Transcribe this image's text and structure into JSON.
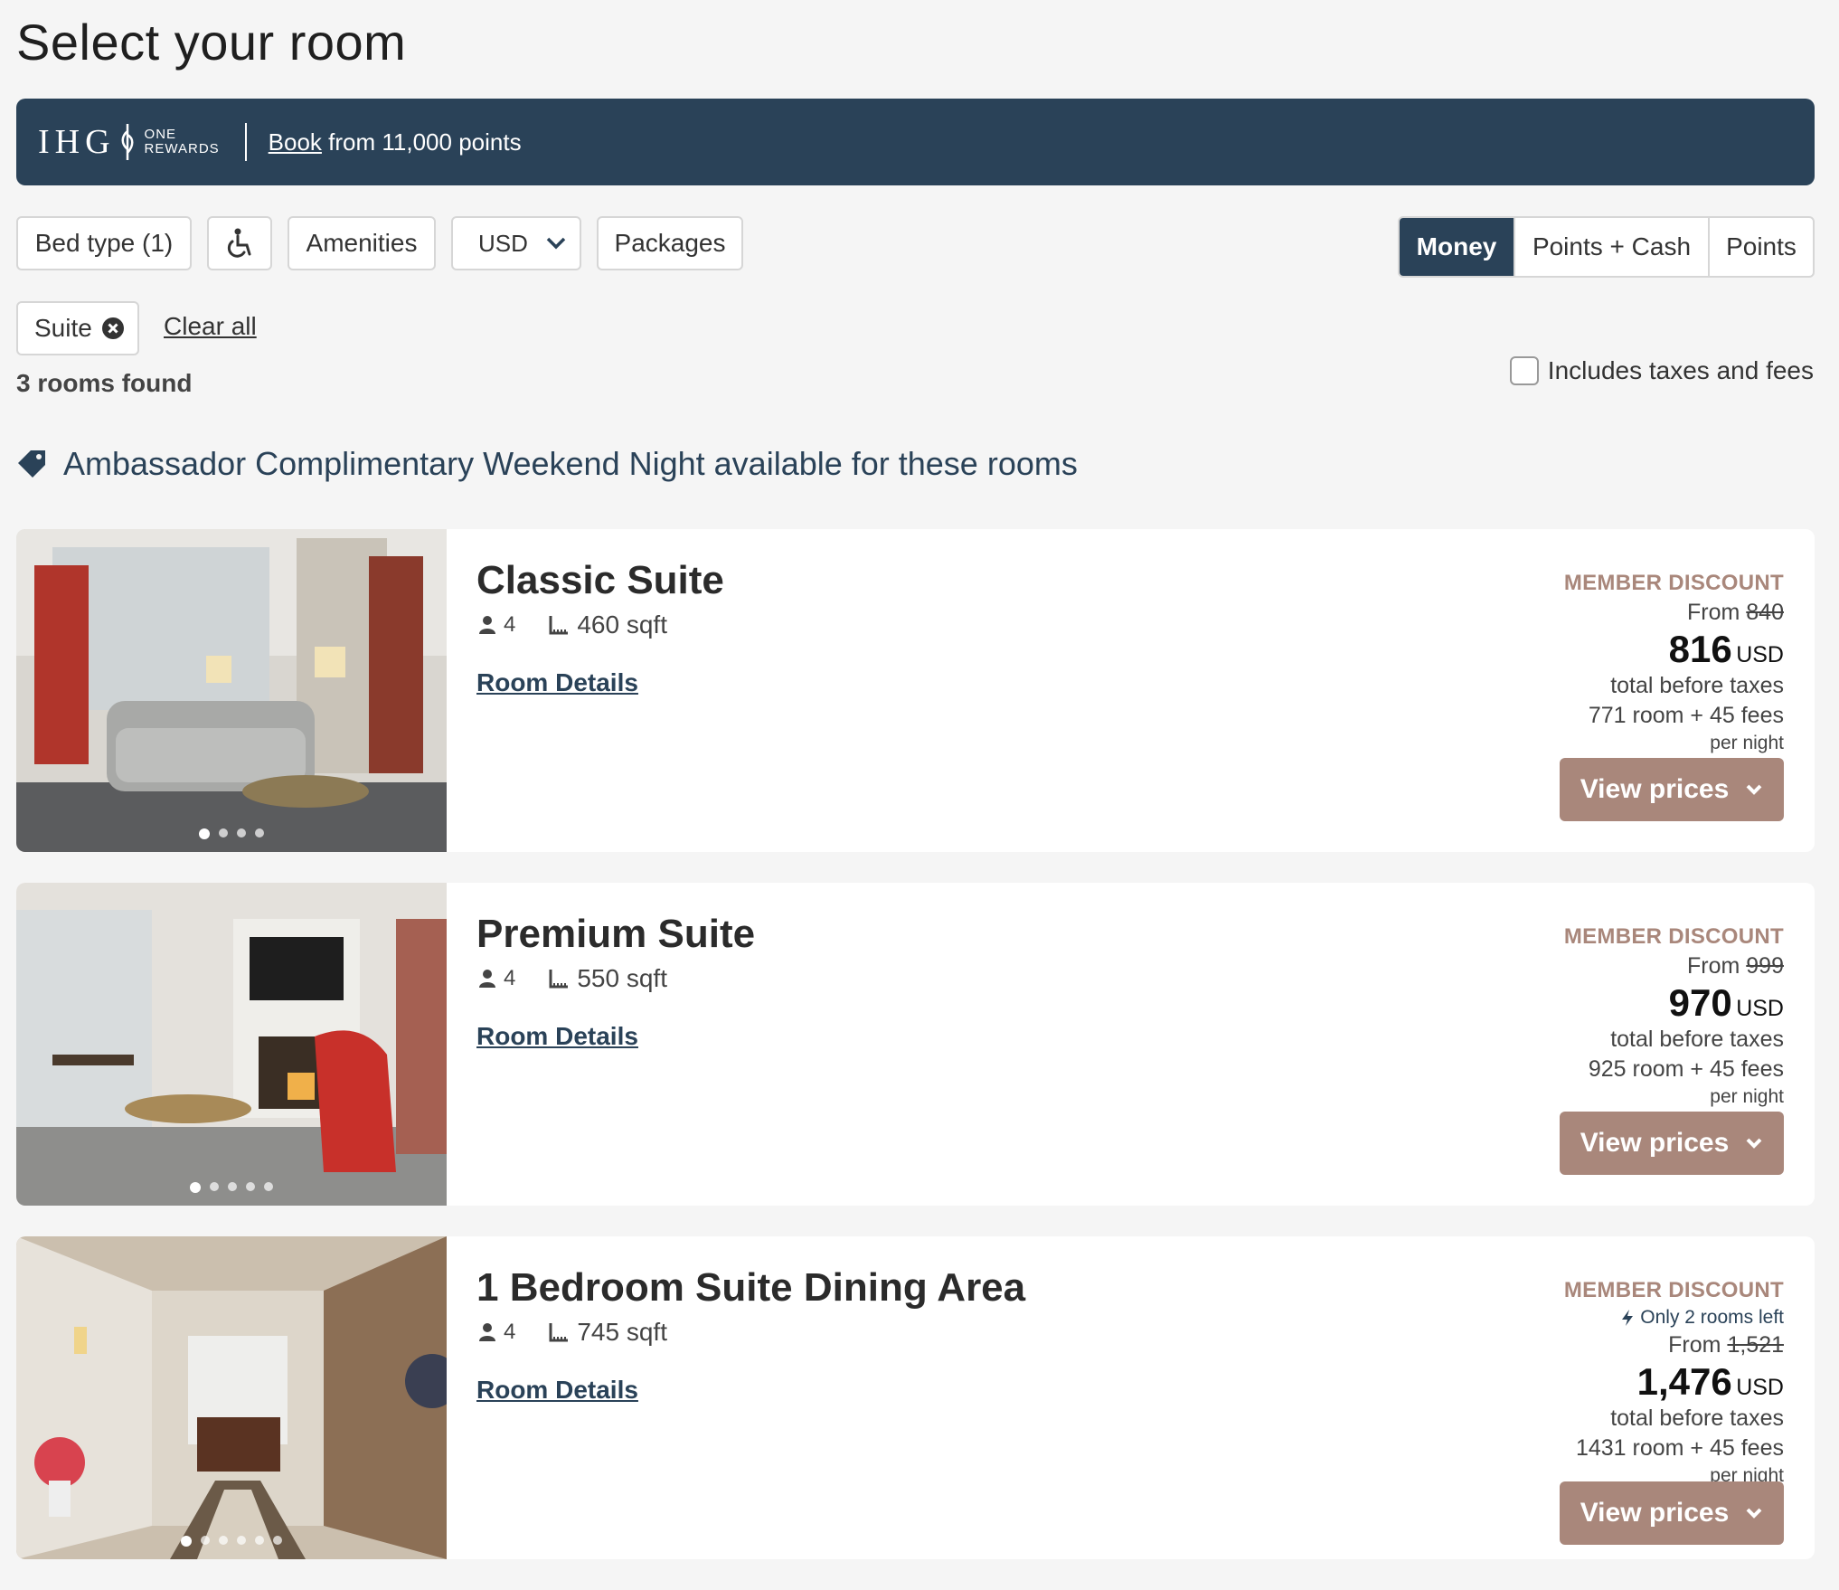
{
  "page_title": "Select your room",
  "banner": {
    "logo_text": "IHG",
    "logo_sub1": "ONE",
    "logo_sub2": "REWARDS",
    "book_link": "Book",
    "book_text": " from 11,000 points",
    "bg_color": "#2a4258"
  },
  "filters": {
    "bed_type": "Bed type (1)",
    "accessibility_icon": "wheelchair-icon",
    "amenities": "Amenities",
    "currency": "USD",
    "packages": "Packages"
  },
  "pay_mode": {
    "options": [
      "Money",
      "Points + Cash",
      "Points"
    ],
    "selected": "Money"
  },
  "active_filter_chip": "Suite",
  "clear_all": "Clear all",
  "rooms_found": "3 rooms found",
  "tax_toggle_label": "Includes taxes and fees",
  "promo_text": "Ambassador Complimentary Weekend Night available for these rooms",
  "accent_color": "#a9877b",
  "rooms": [
    {
      "name": "Classic Suite",
      "guests": "4",
      "sqft": "460 sqft",
      "details_link": "Room Details",
      "member_label": "MEMBER DISCOUNT",
      "rooms_left": "",
      "from_label": "From",
      "original_price": "840",
      "price": "816",
      "currency": "USD",
      "total_label": "total before taxes",
      "breakdown": "771 room + 45 fees",
      "per_night": "per night",
      "view_prices": "View prices"
    },
    {
      "name": "Premium Suite",
      "guests": "4",
      "sqft": "550 sqft",
      "details_link": "Room Details",
      "member_label": "MEMBER DISCOUNT",
      "rooms_left": "",
      "from_label": "From",
      "original_price": "999",
      "price": "970",
      "currency": "USD",
      "total_label": "total before taxes",
      "breakdown": "925 room + 45 fees",
      "per_night": "per night",
      "view_prices": "View prices"
    },
    {
      "name": "1 Bedroom Suite Dining Area",
      "guests": "4",
      "sqft": "745 sqft",
      "details_link": "Room Details",
      "member_label": "MEMBER DISCOUNT",
      "rooms_left": "Only 2 rooms left",
      "from_label": "From",
      "original_price": "1,521",
      "price": "1,476",
      "currency": "USD",
      "total_label": "total before taxes",
      "breakdown": "1431 room + 45 fees",
      "per_night": "per night",
      "view_prices": "View prices"
    }
  ]
}
